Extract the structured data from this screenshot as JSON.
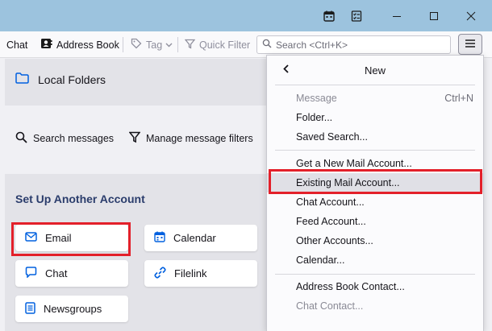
{
  "titlebar": {
    "icons": [
      "calendar-icon",
      "tasks-icon",
      "minimize-icon",
      "maximize-icon",
      "close-icon"
    ]
  },
  "toolbar": {
    "chat": "Chat",
    "address_book": "Address Book",
    "tag": "Tag",
    "quick_filter": "Quick Filter",
    "search_placeholder": "Search <Ctrl+K>"
  },
  "main": {
    "local_folders": "Local Folders",
    "search_messages": "Search messages",
    "manage_filters": "Manage message filters",
    "setup_heading": "Set Up Another Account",
    "cards": {
      "email": "Email",
      "calendar": "Calendar",
      "chat": "Chat",
      "filelink": "Filelink",
      "newsgroups": "Newsgroups"
    }
  },
  "menu": {
    "title": "New",
    "items": {
      "message": "Message",
      "message_shortcut": "Ctrl+N",
      "folder": "Folder...",
      "saved_search": "Saved Search...",
      "get_new_mail": "Get a New Mail Account...",
      "existing_mail": "Existing Mail Account...",
      "chat_account": "Chat Account...",
      "feed_account": "Feed Account...",
      "other_accounts": "Other Accounts...",
      "calendar": "Calendar...",
      "address_book_contact": "Address Book Contact...",
      "chat_contact": "Chat Contact..."
    }
  },
  "colors": {
    "titlebar": "#9cc3de",
    "highlight": "#e3202a",
    "accent": "#0060df",
    "heading": "#2b3d6c"
  }
}
